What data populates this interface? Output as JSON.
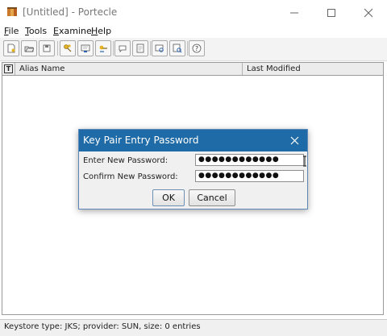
{
  "window": {
    "title": "[Untitled] - Portecle",
    "controls": {
      "minimize": "—",
      "maximize": "☐",
      "close": "✕"
    }
  },
  "menu": [
    {
      "label": "File",
      "mnemonic": "F",
      "rest": "ile"
    },
    {
      "label": "Tools",
      "mnemonic": "T",
      "rest": "ools"
    },
    {
      "label": "Examine",
      "mnemonic": "E",
      "rest": "xamine"
    },
    {
      "label": "Help",
      "mnemonic": "H",
      "rest": "elp"
    }
  ],
  "toolbar": {
    "icons": [
      "new-keystore-icon",
      "open-keystore-icon",
      "save-keystore-icon",
      "generate-key-pair-icon",
      "import-trusted-certificate-icon",
      "import-key-pair-icon",
      "set-keystore-password-icon",
      "keystore-report-icon",
      "examine-certificate-icon",
      "examine-crl-icon",
      "examine-csr-icon",
      "help-icon"
    ]
  },
  "table": {
    "columns": [
      "",
      "Alias Name",
      "Last Modified"
    ],
    "type_header_glyph": "T"
  },
  "status": "Keystore type: JKS; provider: SUN, size: 0 entries",
  "dialog": {
    "title": "Key Pair Entry Password",
    "enter_label": "Enter New Password:",
    "confirm_label": "Confirm New Password:",
    "enter_value": "●●●●●●●●●●●●",
    "confirm_value": "●●●●●●●●●●●●",
    "ok_label": "OK",
    "cancel_label": "Cancel"
  },
  "colors": {
    "dialog_title_bar": "#1e6ba8",
    "toolbar_bg": "#f3f3f3"
  }
}
